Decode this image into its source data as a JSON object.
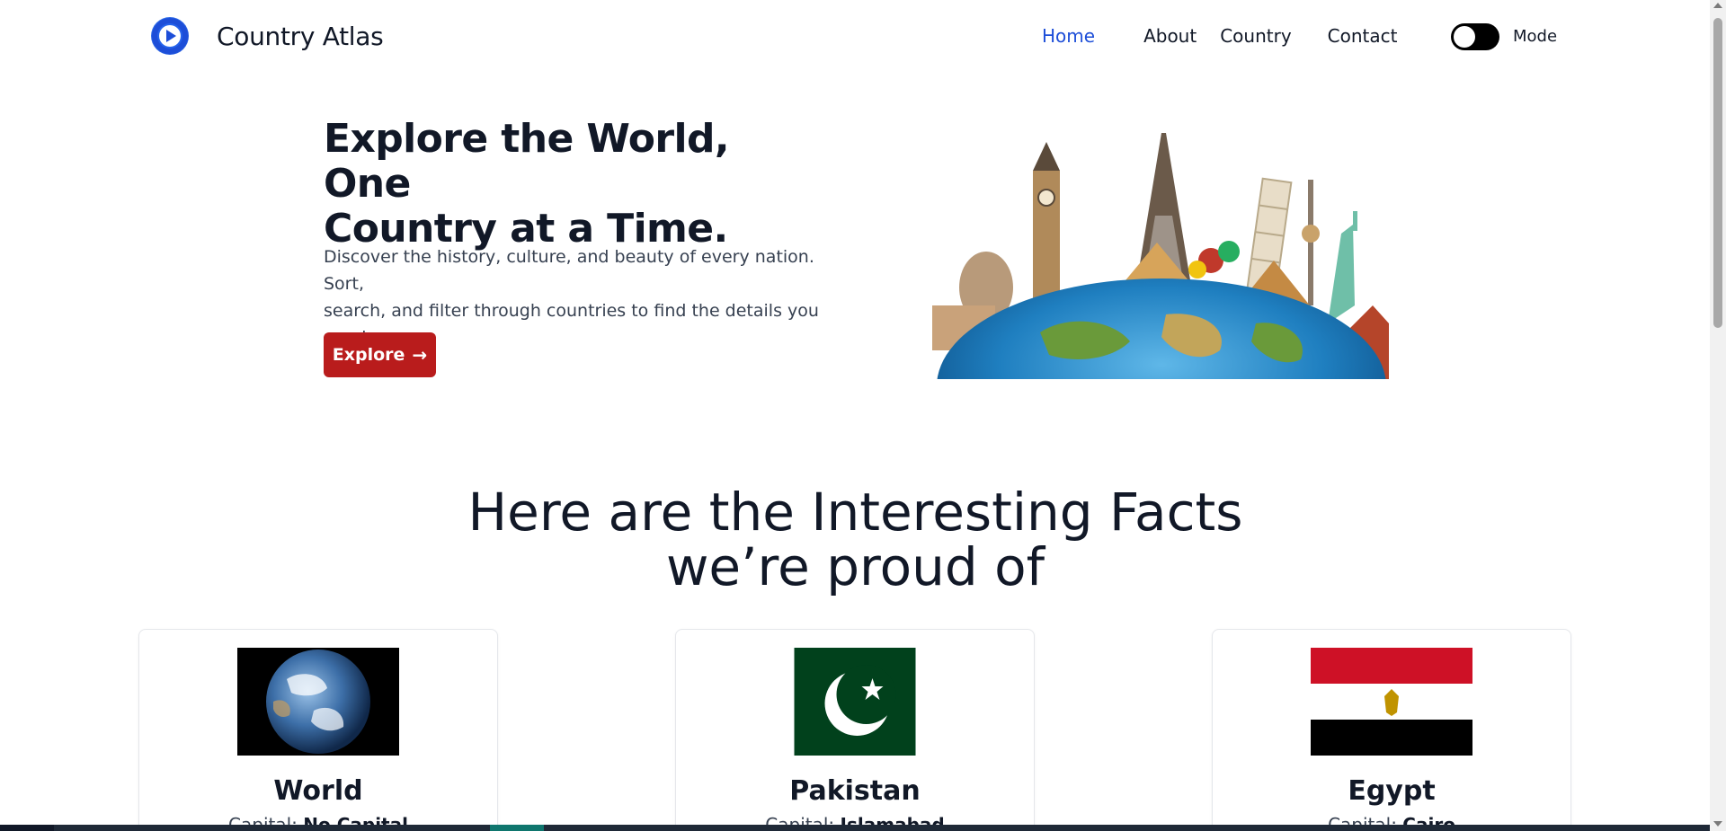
{
  "brand": {
    "title": "Country Atlas",
    "logo_icon": "play-circle-icon"
  },
  "nav": {
    "items": [
      {
        "label": "Home",
        "active": true
      },
      {
        "label": "About",
        "active": false
      },
      {
        "label": "Country",
        "active": false
      },
      {
        "label": "Contact",
        "active": false
      }
    ],
    "mode_label": "Mode",
    "mode_toggle_on": false
  },
  "hero": {
    "title_line1": "Explore the World, One",
    "title_line2": "Country at a Time.",
    "description_line1": "Discover the history, culture, and beauty of every nation. Sort,",
    "description_line2": "search, and filter through countries to find the details you need.",
    "button_label": "Explore",
    "button_icon": "arrow-right-icon"
  },
  "facts": {
    "heading_line1": "Here are the Interesting Facts",
    "heading_line2": "we’re proud of",
    "cards": [
      {
        "name": "World",
        "capital_label": "Capital:",
        "capital": "No Capital"
      },
      {
        "name": "Pakistan",
        "capital_label": "Capital:",
        "capital": "Islamabad"
      },
      {
        "name": "Egypt",
        "capital_label": "Capital:",
        "capital": "Cairo"
      }
    ]
  },
  "colors": {
    "accent": "#1d4ed8",
    "button": "#b91c1c",
    "text": "#111827"
  }
}
